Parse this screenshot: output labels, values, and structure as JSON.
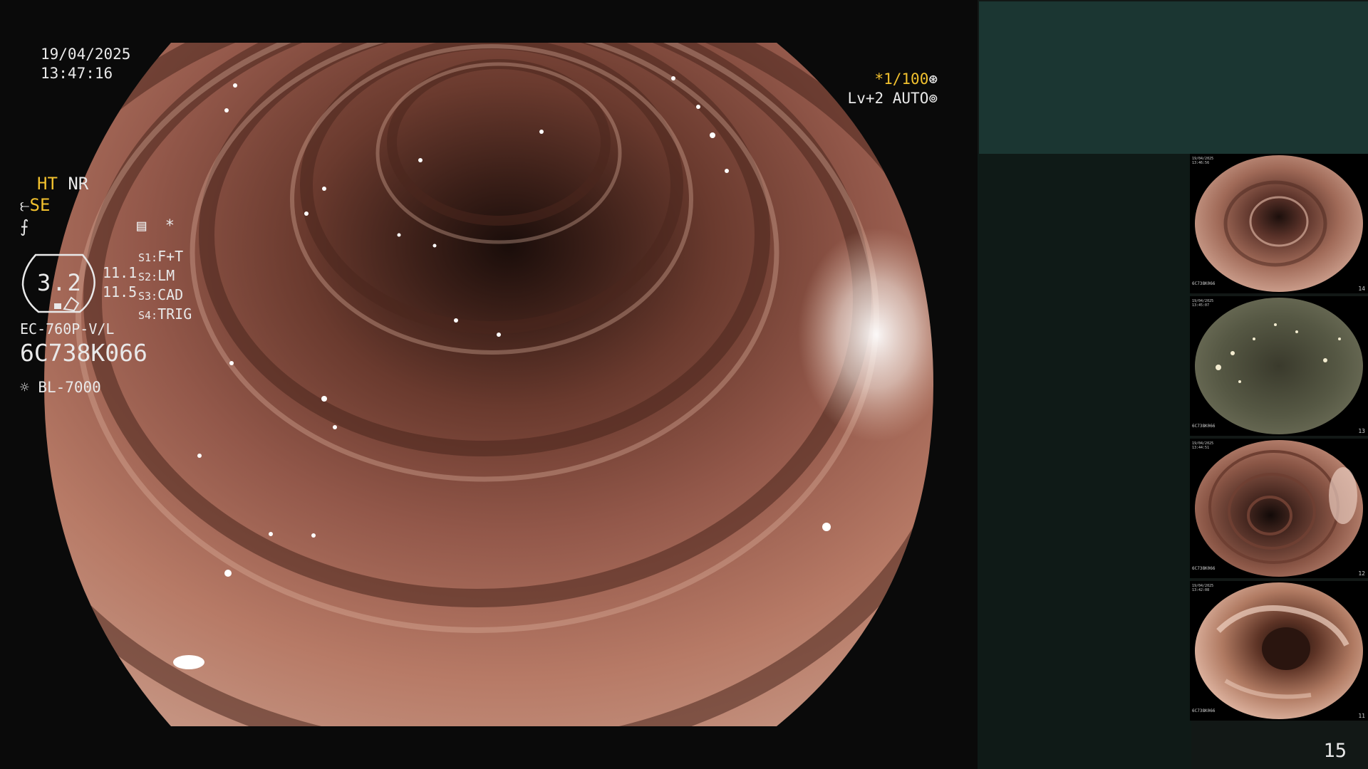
{
  "overlay": {
    "date": "19/04/2025",
    "time": "13:47:16",
    "shutter": "*1/100",
    "shutter_icon": "aperture-icon",
    "level": "Lv+2 AUTO",
    "level_icon": "iris-icon"
  },
  "panel": {
    "ht": "HT",
    "nr": "NR",
    "se": "SE",
    "gauge_value": "3.2",
    "side_top": "11.1",
    "side_bottom": "11.5",
    "s_settings": [
      {
        "tag": "S1:",
        "value": "F+T"
      },
      {
        "tag": "S2:",
        "value": "LM"
      },
      {
        "tag": "S3:",
        "value": "CAD"
      },
      {
        "tag": "S4:",
        "value": "TRIG"
      }
    ],
    "config_star": "*",
    "scope_model": "EC-760P-V/L",
    "serial": "6C738K066",
    "light_source": "BL-7000",
    "page_number": "15"
  },
  "colors": {
    "accent_yellow": "#f2c12e",
    "panel_top": "#1b3632",
    "panel_bg": "#121816",
    "text": "#e9e9e9"
  },
  "thumbnails": [
    {
      "number": "14",
      "date": "19/04/2025",
      "time": "13:46:56",
      "serial": "6C738K066"
    },
    {
      "number": "13",
      "date": "19/04/2025",
      "time": "13:45:07",
      "serial": "6C738K066"
    },
    {
      "number": "12",
      "date": "19/04/2025",
      "time": "13:44:51",
      "serial": "6C738K066"
    },
    {
      "number": "11",
      "date": "19/04/2025",
      "time": "13:42:08",
      "serial": "6C738K066"
    }
  ]
}
